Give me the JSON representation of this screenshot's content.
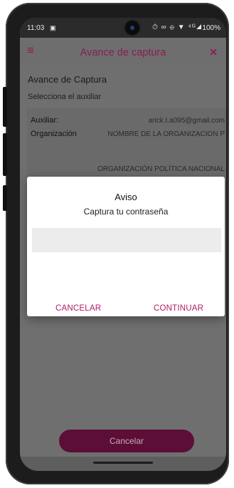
{
  "status_bar": {
    "time": "11:03",
    "notification_icon": "calendar-icon",
    "icons": "⏱ ∞ ⊕ ▼ ⁴ᴳ◢",
    "battery": "100%"
  },
  "app_bar": {
    "title": "Avance de captura",
    "menu_icon": "hamburger-icon",
    "close_icon": "close-icon",
    "accent_color": "#8a1e55"
  },
  "content": {
    "title": "Avance de Captura",
    "subtitle": "Selecciona el auxiliar",
    "card": {
      "aux_label": "Auxiliar:",
      "aux_value": "arick.t.a095@gmail.com",
      "org_label": "Organización",
      "org_value": "NOMBRE DE LA ORGANIZACION P",
      "org_type": "ORGANIZACIÓN POLÍTICA NACIONAL"
    }
  },
  "dialog": {
    "title": "Aviso",
    "message": "Captura tu contraseña",
    "input_value": "",
    "cancel_label": "CANCELAR",
    "continue_label": "CONTINUAR",
    "button_color": "#b0196a"
  },
  "bottom": {
    "cancel_label": "Cancelar"
  }
}
